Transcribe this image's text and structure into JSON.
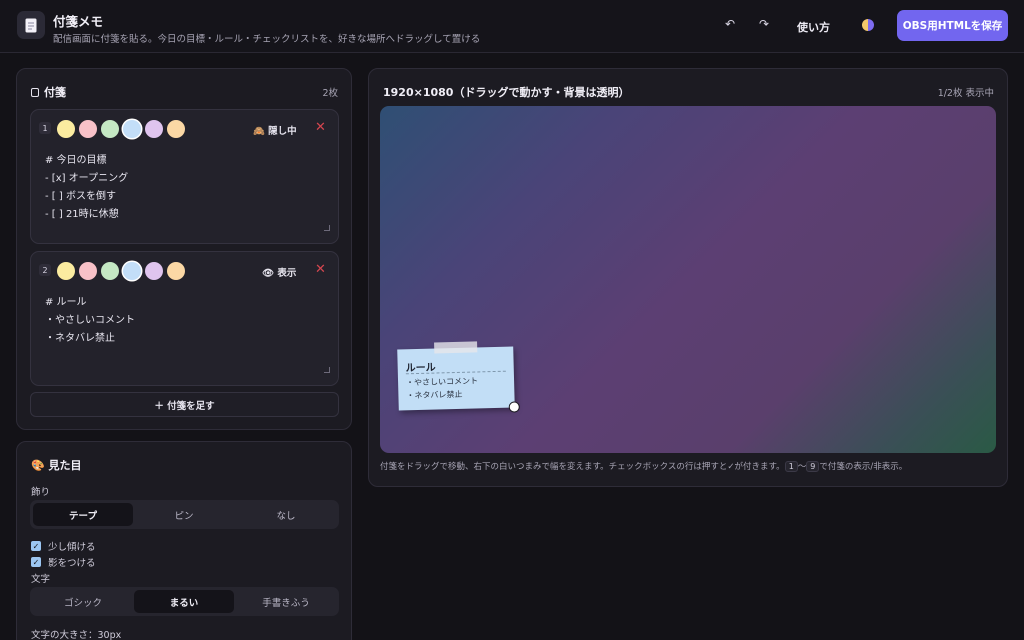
{
  "header": {
    "icon": "note-icon",
    "title": "付箋メモ",
    "subtitle": "配信画面に付箋を貼る。今日の目標・ルール・チェックリストを、好きな場所へドラッグして置ける",
    "undo": "↶",
    "redo": "↷",
    "help_label": "使い方",
    "save_label": "OBS用HTMLを保存"
  },
  "notes_panel": {
    "title": "付箋",
    "count": "2枚",
    "add_label": "＋ 付箋を足す",
    "notes": [
      {
        "number": "1",
        "visibility_label": "🙈 隠し中",
        "text": "# 今日の目標\n- [x] オープニング\n- [ ] ボスを倒す\n- [ ] 21時に休憩"
      },
      {
        "number": "2",
        "visibility_label": "👁 表示",
        "text": "# ルール\n・やさしいコメント\n・ネタバレ禁止"
      }
    ]
  },
  "look_panel": {
    "title": "🎨 見た目",
    "decoration_label": "飾り",
    "decoration_options": [
      "テープ",
      "ピン",
      "なし"
    ],
    "decoration_selected": "テープ",
    "tilt_label": "少し傾ける",
    "shadow_label": "影をつける",
    "font_label": "文字",
    "font_options": [
      "ゴシック",
      "まるい",
      "手書きふう"
    ],
    "font_selected": "まるい",
    "font_size_label": "文字の大きさ：30px"
  },
  "preview": {
    "title": "1920×1080（ドラッグで動かす・背景は透明）",
    "status": "1/2枚 表示中",
    "sticky_title": "ルール",
    "sticky_body": "・やさしいコメント\n・ネタバレ禁止",
    "hint_before": "付箋をドラッグで移動、右下の白いつまみで幅を変えます。チェックボックスの行は押すと✓が付きます。",
    "key_start": "1",
    "key_sep": "〜",
    "key_end": "9",
    "hint_after": "で付箋の表示/非表示。"
  },
  "colors": {
    "accent": "#7266ef",
    "swatches": [
      "#fbeca0",
      "#f8c1c8",
      "#c5e8c4",
      "#c3def8",
      "#dfc4ee",
      "#fbd8a5"
    ],
    "delete": "#d4464f"
  }
}
